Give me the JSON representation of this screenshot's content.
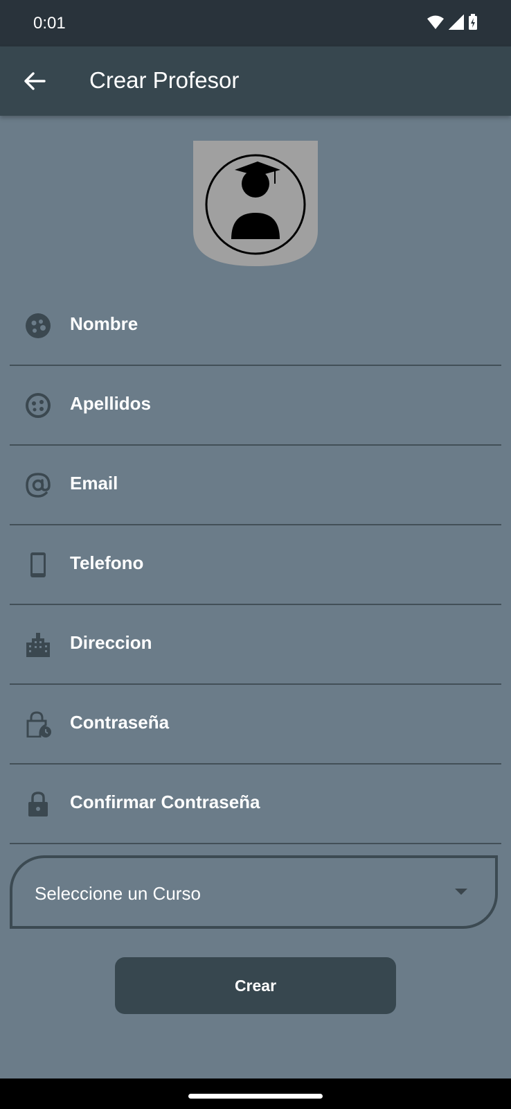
{
  "status_bar": {
    "time": "0:01"
  },
  "app_bar": {
    "title": "Crear Profesor"
  },
  "form": {
    "fields": [
      {
        "label": "Nombre",
        "icon": "face-icon"
      },
      {
        "label": "Apellidos",
        "icon": "face-outline-icon"
      },
      {
        "label": "Email",
        "icon": "at-icon"
      },
      {
        "label": "Telefono",
        "icon": "phone-icon"
      },
      {
        "label": "Direccion",
        "icon": "building-icon"
      },
      {
        "label": "Contraseña",
        "icon": "lock-clock-icon"
      },
      {
        "label": "Confirmar Contraseña",
        "icon": "lock-icon"
      }
    ],
    "course_select": {
      "placeholder": "Seleccione un Curso"
    },
    "submit_label": "Crear"
  },
  "colors": {
    "background": "#6b7c89",
    "app_bar": "#37474f",
    "status_bar": "#29333b",
    "icon": "#3b4850"
  }
}
